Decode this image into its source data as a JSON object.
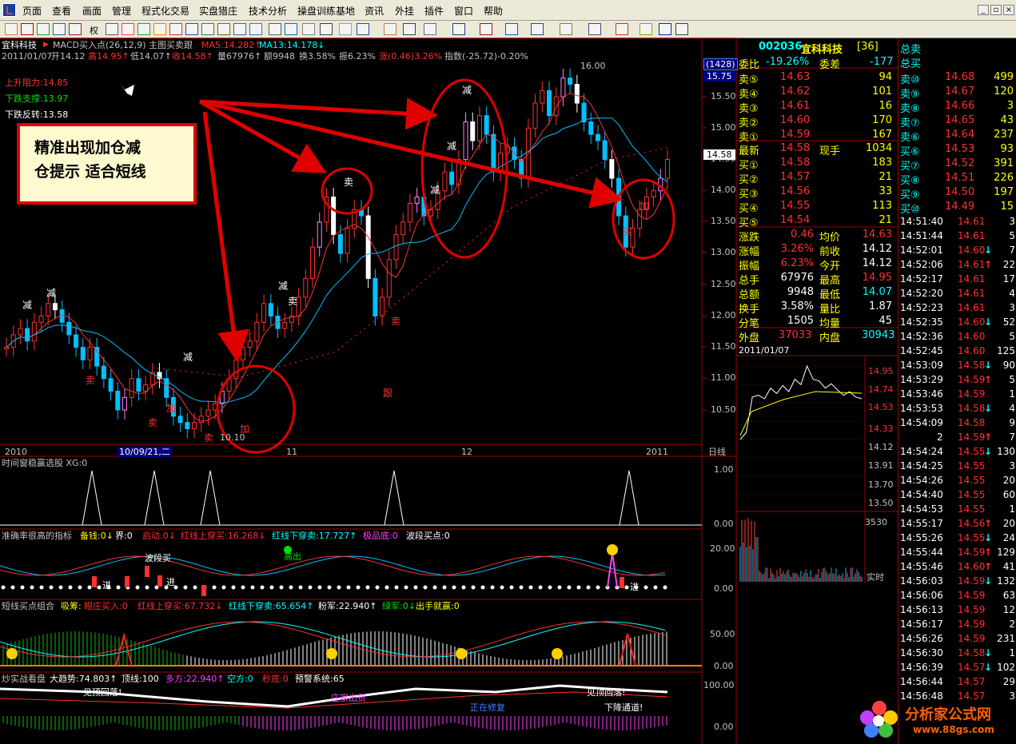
{
  "menu": [
    "页面",
    "查看",
    "画面",
    "管理",
    "程式化交易",
    "实盘猎庄",
    "技术分析",
    "操盘训练基地",
    "资讯",
    "外挂",
    "插件",
    "窗口",
    "帮助"
  ],
  "toolbar": {
    "qq_label": "权"
  },
  "header": {
    "stock_name": "宜科科技",
    "indicator_line": "MACD买入点(26,12,9) 主图买卖跟",
    "ma5": "MA5:14.282↑",
    "ma13": "MA13:14.178↓",
    "date": "2011/01/07",
    "open": "开14.12",
    "high": "高14.95↑",
    "low": "低14.07↑",
    "close": "收14.58↑",
    "volume": "量67976↑",
    "amount": "额9948",
    "turnover": "换3.58%",
    "amplitude": "振6.23%",
    "change": "涨(0.46)3.26%",
    "index": "指数(-25.72)-0.20%"
  },
  "levels": {
    "resist": "上升阻力:14.85",
    "support": "下跌支撑:13.97",
    "rebound": "下跌反转:13.58"
  },
  "annotation_text": [
    "精准出现加仓减",
    "仓提示 适合短线"
  ],
  "price_axis": [
    "16.00",
    "15.50",
    "15.00",
    "14.50",
    "14.00",
    "13.50",
    "13.00",
    "12.50",
    "12.00",
    "11.50",
    "11.00",
    "10.50"
  ],
  "axis_badges": {
    "count": "(1428)",
    "top": "15.75",
    "current": "14.58"
  },
  "price_marks": {
    "high": "16.00",
    "low": "10.10"
  },
  "signals": [
    {
      "t": "减",
      "c": "white"
    },
    {
      "t": "减",
      "c": "white"
    },
    {
      "t": "卖",
      "c": "red"
    },
    {
      "t": "加",
      "c": "red"
    },
    {
      "t": "卖",
      "c": "red"
    },
    {
      "t": "减",
      "c": "white"
    },
    {
      "t": "卖",
      "c": "red"
    },
    {
      "t": "加",
      "c": "red"
    },
    {
      "t": "减",
      "c": "white"
    },
    {
      "t": "卖",
      "c": "white"
    },
    {
      "t": "卖",
      "c": "white"
    },
    {
      "t": "卖",
      "c": "red"
    },
    {
      "t": "跟",
      "c": "red"
    },
    {
      "t": "减",
      "c": "white"
    },
    {
      "t": "减",
      "c": "white"
    },
    {
      "t": "减",
      "c": "white"
    },
    {
      "t": "加",
      "c": "red"
    },
    {
      "t": "买",
      "c": "red"
    }
  ],
  "date_axis": [
    "2010",
    "10/09/21,二",
    "11",
    "12",
    "2011",
    "日线"
  ],
  "pane1": {
    "title": "时间窗稳赢选股 XG:0",
    "axis": [
      "1.00",
      "0.00"
    ]
  },
  "pane2": {
    "title": "准确率很高的指标",
    "fields": [
      "备钱:0↓",
      "界:0",
      "启动:0↓",
      "红线上穿买:16.268↓",
      "红线下穿卖:17.727↑",
      "极品底:0",
      "波段买点:0"
    ],
    "axis": [
      "20.00",
      "0.00"
    ],
    "labels": [
      "波段买",
      "进",
      "进",
      "高出",
      "进"
    ]
  },
  "pane3": {
    "title": "短线买点组合",
    "fields": [
      "吸筹:",
      "眼庄买入:0",
      "红线上穿买:67.732↓",
      "红线下穿卖:65.654↑",
      "粉军:22.940↑",
      "绿军:0↓",
      "出手就赢:0"
    ],
    "axis": [
      "50.00",
      "0.00"
    ]
  },
  "pane4": {
    "title": "炒实战看盘",
    "fields": [
      "大趋势:74.803↑",
      "顶线:100",
      "多方:22.940↑",
      "空方:0",
      "秒底:0",
      "预警系统:65"
    ],
    "axis": [
      "100.00",
      "0.00"
    ],
    "labels": [
      "见顶回落!",
      "庄家出货",
      "正在修复",
      "见顶回落!",
      "下降通道!"
    ]
  },
  "quote": {
    "code": "002036",
    "name": "宜科科技",
    "num": "[36]",
    "weibi_label": "委比",
    "weibi": "-19.26%",
    "weicha_label": "委差",
    "weicha": "-177",
    "sell": [
      {
        "l": "卖⑤",
        "p": "14.63",
        "v": "94"
      },
      {
        "l": "卖④",
        "p": "14.62",
        "v": "101"
      },
      {
        "l": "卖③",
        "p": "14.61",
        "v": "16"
      },
      {
        "l": "卖②",
        "p": "14.60",
        "v": "170"
      },
      {
        "l": "卖①",
        "p": "14.59",
        "v": "167"
      }
    ],
    "latest": {
      "l": "最新",
      "p": "14.58",
      "m": "现手",
      "v": "1034"
    },
    "buy": [
      {
        "l": "买①",
        "p": "14.58",
        "v": "183"
      },
      {
        "l": "买②",
        "p": "14.57",
        "v": "21"
      },
      {
        "l": "买③",
        "p": "14.56",
        "v": "33"
      },
      {
        "l": "买④",
        "p": "14.55",
        "v": "113"
      },
      {
        "l": "买⑤",
        "p": "14.54",
        "v": "21"
      }
    ],
    "stats": [
      {
        "a": "涨跌",
        "av": "0.46",
        "b": "均价",
        "bv": "14.63"
      },
      {
        "a": "涨幅",
        "av": "3.26%",
        "b": "前收",
        "bv": "14.12"
      },
      {
        "a": "振幅",
        "av": "6.23%",
        "b": "今开",
        "bv": "14.12"
      },
      {
        "a": "总手",
        "av": "67976",
        "b": "最高",
        "bv": "14.95"
      },
      {
        "a": "总额",
        "av": "9948",
        "b": "最低",
        "bv": "14.07"
      },
      {
        "a": "换手",
        "av": "3.58%",
        "b": "量比",
        "bv": "1.87"
      },
      {
        "a": "分笔",
        "av": "1505",
        "b": "均量",
        "bv": "45"
      }
    ],
    "outer": {
      "l": "外盘",
      "v": "37033",
      "l2": "内盘",
      "v2": "30943"
    }
  },
  "intraday": {
    "date": "2011/01/07",
    "axis": [
      "14.95",
      "14.74",
      "14.53",
      "14.33",
      "14.12",
      "13.91",
      "13.70",
      "13.50"
    ],
    "vol_axis": "3530",
    "label": "实时"
  },
  "right": {
    "head": [
      "总卖",
      "总买"
    ],
    "sell": [
      {
        "l": "卖⑩",
        "p": "14.68",
        "v": "499"
      },
      {
        "l": "卖⑨",
        "p": "14.67",
        "v": "120"
      },
      {
        "l": "卖⑧",
        "p": "14.66",
        "v": "3"
      },
      {
        "l": "卖⑦",
        "p": "14.65",
        "v": "43"
      },
      {
        "l": "卖⑥",
        "p": "14.64",
        "v": "237"
      }
    ],
    "buy": [
      {
        "l": "买⑥",
        "p": "14.53",
        "v": "93"
      },
      {
        "l": "买⑦",
        "p": "14.52",
        "v": "391"
      },
      {
        "l": "买⑧",
        "p": "14.51",
        "v": "226"
      },
      {
        "l": "买⑨",
        "p": "14.50",
        "v": "197"
      },
      {
        "l": "买⑩",
        "p": "14.49",
        "v": "15"
      }
    ],
    "ticks": [
      {
        "t": "14:51:40",
        "p": "14.61",
        "a": "",
        "v": "3"
      },
      {
        "t": "14:51:44",
        "p": "14.61",
        "a": "",
        "v": "5"
      },
      {
        "t": "14:52:01",
        "p": "14.60",
        "a": "↓",
        "v": "7"
      },
      {
        "t": "14:52:06",
        "p": "14.61",
        "a": "↑",
        "v": "22"
      },
      {
        "t": "14:52:17",
        "p": "14.61",
        "a": "",
        "v": "17"
      },
      {
        "t": "14:52:20",
        "p": "14.61",
        "a": "",
        "v": "4"
      },
      {
        "t": "14:52:23",
        "p": "14.61",
        "a": "",
        "v": "3"
      },
      {
        "t": "14:52:35",
        "p": "14.60",
        "a": "↓",
        "v": "52"
      },
      {
        "t": "14:52:36",
        "p": "14.60",
        "a": "",
        "v": "5"
      },
      {
        "t": "14:52:45",
        "p": "14.60",
        "a": "",
        "v": "125"
      },
      {
        "t": "14:53:09",
        "p": "14.58",
        "a": "↓",
        "v": "90"
      },
      {
        "t": "14:53:29",
        "p": "14.59",
        "a": "↑",
        "v": "5"
      },
      {
        "t": "14:53:46",
        "p": "14.59",
        "a": "",
        "v": "1"
      },
      {
        "t": "14:53:53",
        "p": "14.58",
        "a": "↓",
        "v": "4"
      },
      {
        "t": "14:54:09",
        "p": "14.58",
        "a": "",
        "v": "9"
      },
      {
        "t": "2",
        "p": "14.59",
        "a": "↑",
        "v": "7"
      },
      {
        "t": "14:54:24",
        "p": "14.55",
        "a": "↓",
        "v": "130"
      },
      {
        "t": "14:54:25",
        "p": "14.55",
        "a": "",
        "v": "3"
      },
      {
        "t": "14:54:26",
        "p": "14.55",
        "a": "",
        "v": "20"
      },
      {
        "t": "14:54:40",
        "p": "14.55",
        "a": "",
        "v": "60"
      },
      {
        "t": "14:54:53",
        "p": "14.55",
        "a": "",
        "v": "1"
      },
      {
        "t": "14:55:17",
        "p": "14.56",
        "a": "↑",
        "v": "20"
      },
      {
        "t": "14:55:26",
        "p": "14.55",
        "a": "↓",
        "v": "24"
      },
      {
        "t": "14:55:44",
        "p": "14.59",
        "a": "↑",
        "v": "129"
      },
      {
        "t": "14:55:46",
        "p": "14.60",
        "a": "↑",
        "v": "41"
      },
      {
        "t": "14:56:03",
        "p": "14.59",
        "a": "↓",
        "v": "132"
      },
      {
        "t": "14:56:06",
        "p": "14.59",
        "a": "",
        "v": "63"
      },
      {
        "t": "14:56:13",
        "p": "14.59",
        "a": "",
        "v": "12"
      },
      {
        "t": "14:56:17",
        "p": "14.59",
        "a": "",
        "v": "2"
      },
      {
        "t": "14:56:26",
        "p": "14.59",
        "a": "",
        "v": "231"
      },
      {
        "t": "14:56:30",
        "p": "14.58",
        "a": "↓",
        "v": "1"
      },
      {
        "t": "14:56:39",
        "p": "14.57",
        "a": "↓",
        "v": "102"
      },
      {
        "t": "14:56:44",
        "p": "14.57",
        "a": "",
        "v": "29"
      },
      {
        "t": "14:56:48",
        "p": "14.57",
        "a": "",
        "v": "3"
      }
    ]
  },
  "watermark": {
    "name": "分析家公式网",
    "url": "www.88gs.com"
  },
  "colors": {
    "up": "#ff3030",
    "down": "#00ffff",
    "bg": "#000000",
    "grid": "#a00000",
    "ma5": "#ffffff",
    "ma13": "#00c0ff"
  }
}
